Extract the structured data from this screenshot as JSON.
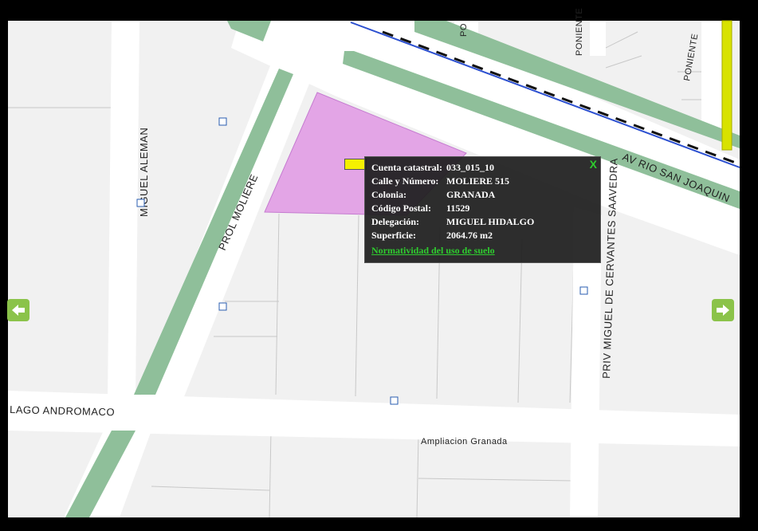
{
  "streets": {
    "av_rio_san_joaquin": "AV RIO SAN JOAQUIN",
    "miguel_aleman": "MIGUEL ALEMAN",
    "prol_moliere": "PROL MOLIERE",
    "lago_andromaco": "LAGO ANDROMACO",
    "priv_miguel_de_cervantes_saavedra": "PRIV MIGUEL DE CERVANTES SAAVEDRA",
    "poniente_1": "PONIENTE",
    "poniente_2": "PONIENTE",
    "poniente_partial": "PO"
  },
  "area_label": "Ampliacion Granada",
  "popup": {
    "rows": [
      {
        "label": "Cuenta catastral:",
        "value": "033_015_10"
      },
      {
        "label": "Calle y Número:",
        "value": "MOLIERE 515"
      },
      {
        "label": "Colonia:",
        "value": "GRANADA"
      },
      {
        "label": "Código Postal:",
        "value": "11529"
      },
      {
        "label": "Delegación:",
        "value": "MIGUEL HIDALGO"
      },
      {
        "label": "Superficie:",
        "value": "2064.76 m2"
      }
    ],
    "link_text": "Normatividad del uso de suelo",
    "close_label": "X"
  },
  "nav": {
    "left_icon": "arrow-left-icon",
    "right_icon": "arrow-right-icon"
  },
  "colors": {
    "map_bg": "#f2f2f2",
    "median": "#8fbf9a",
    "parcel_highlight": "#e3a5e6",
    "popup_bg": "#1e1e1e",
    "link_green": "#2ecc2e",
    "nav_green": "#8bc34a"
  }
}
